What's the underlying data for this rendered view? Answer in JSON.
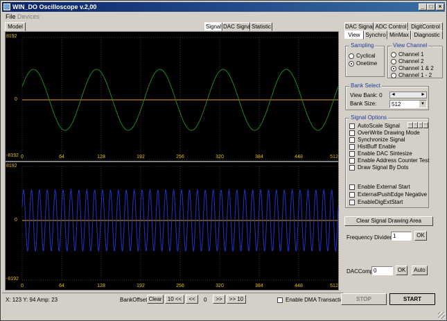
{
  "window": {
    "title": "WIN_DO Oscilloscope v.2,00",
    "min": "_",
    "max": "□",
    "close": "×"
  },
  "menu": {
    "file": "File",
    "devices": "Devices"
  },
  "left_tabs": {
    "model": "Model",
    "signal": "Signal",
    "dac_signal": "DAC Signal",
    "statistic": "Statistic"
  },
  "right_tabs_top": {
    "dac_signal": "DAC Signal",
    "adc_control": "ADC Control",
    "digit_control": "DigitControl"
  },
  "right_tabs_bottom": {
    "view": "View",
    "synchro": "Synchro",
    "minmax": "MinMax",
    "diagnostic": "Diagnostic"
  },
  "scope_top": {
    "y_labels": {
      "top": "8192",
      "mid": "0",
      "bottom": "-8192"
    },
    "x_labels": [
      "0",
      "64",
      "128",
      "192",
      "256",
      "320",
      "384",
      "448",
      "512"
    ],
    "signal_color": "#1e8a1e"
  },
  "scope_bottom": {
    "y_labels": {
      "top": "8192",
      "mid": "0",
      "bottom": "-8192"
    },
    "x_labels": [
      "0",
      "64",
      "128",
      "192",
      "256",
      "320",
      "384",
      "448",
      "512"
    ],
    "signal_color": "#2233cc"
  },
  "sampling": {
    "title": "Sampling",
    "options": [
      "Cyclical",
      "Onetime"
    ],
    "selected": 1
  },
  "view_channel": {
    "title": "View Channel",
    "options": [
      "Channel 1",
      "Channel 2",
      "Channel 1 & 2",
      "Channel 1 - 2"
    ],
    "selected": 2
  },
  "bank_select": {
    "title": "Bank Select",
    "view_bank_label": "View Bank: 0",
    "bank_size_label": "Bank Size:",
    "bank_size_value": "512"
  },
  "signal_options": {
    "title": "Signal Options",
    "autoscale": "AutoScale Signal",
    "nav": [
      "<<",
      "<",
      ">",
      ">>"
    ],
    "items": [
      "OverWrite Drawing Mode",
      "Synchronize Signal",
      "HistBuff Enable",
      "Enable DAC Sintesize",
      "Enable Address Counter Test",
      "Draw Signal By Dots"
    ],
    "items2": [
      "Enable External Start",
      "ExternalPushEdge Negative",
      "EnableDigExtStart"
    ]
  },
  "clear_button": "Clear Signal Drawing Area",
  "freq_divider": {
    "label": "Frequency Divider",
    "value": "1",
    "ok": "OK"
  },
  "dac_comp": {
    "label": "DACComp",
    "value": "0",
    "ok": "OK",
    "auto": "Auto"
  },
  "status": {
    "readout": "X: 123  Y: 94  Amp: 23",
    "bank_offset": "BankOffset",
    "clear": "Clear",
    "b10l": "10 <<",
    "bl": "<<",
    "value": "0",
    "br": ">>",
    "b10r": ">> 10"
  },
  "dma": "Enable DMA Transaction",
  "stop": "STOP",
  "start": "START"
}
